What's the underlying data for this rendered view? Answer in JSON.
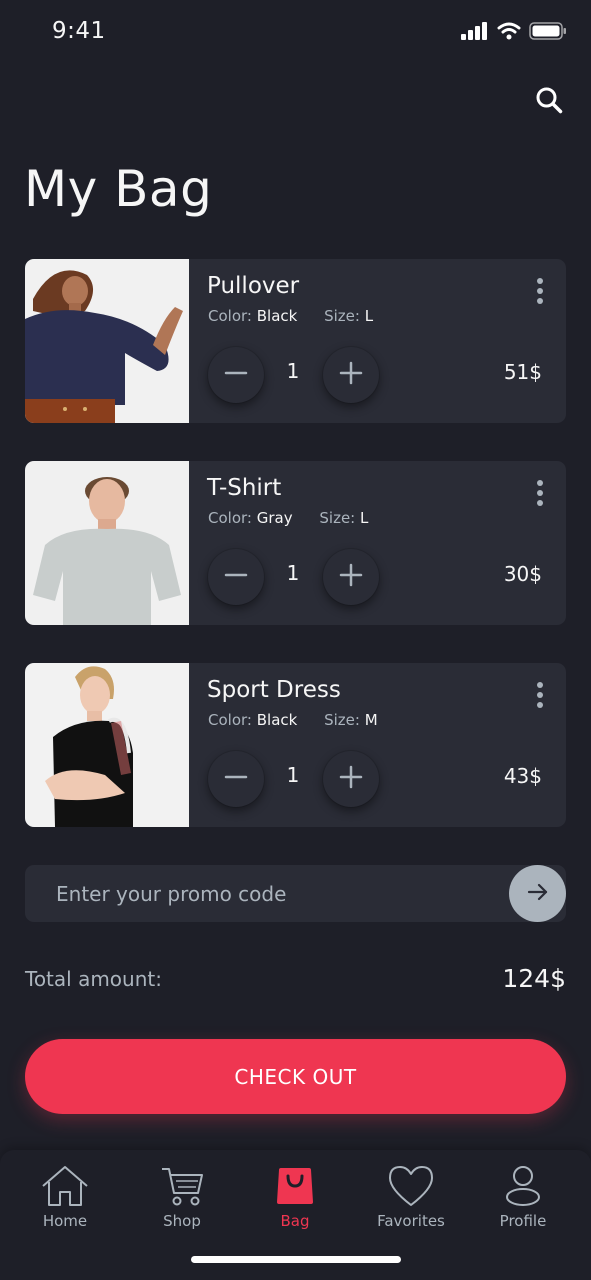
{
  "status_bar": {
    "time": "9:41",
    "icons": [
      "signal-icon",
      "wifi-icon",
      "battery-icon"
    ]
  },
  "header": {
    "search_icon": "search-icon",
    "title": "My Bag"
  },
  "labels": {
    "color": "Color:",
    "size": "Size:"
  },
  "cart_items": [
    {
      "name": "Pullover",
      "color": "Black",
      "size": "L",
      "quantity": "1",
      "price": "51$",
      "image": "woman-navy-pullover"
    },
    {
      "name": "T-Shirt",
      "color": "Gray",
      "size": "L",
      "quantity": "1",
      "price": "30$",
      "image": "man-gray-tshirt"
    },
    {
      "name": "Sport Dress",
      "color": "Black",
      "size": "M",
      "quantity": "1",
      "price": "43$",
      "image": "woman-black-sport-dress"
    }
  ],
  "promo": {
    "placeholder": "Enter your promo code",
    "submit_icon": "arrow-right-icon"
  },
  "total": {
    "label": "Total amount:",
    "value": "124$"
  },
  "checkout": {
    "label": "CHECK OUT"
  },
  "tab_bar": {
    "active": "bag",
    "items": [
      {
        "label": "Home",
        "icon": "home-icon"
      },
      {
        "label": "Shop",
        "icon": "cart-icon"
      },
      {
        "label": "Bag",
        "icon": "bag-icon"
      },
      {
        "label": "Favorites",
        "icon": "heart-icon"
      },
      {
        "label": "Profile",
        "icon": "profile-icon"
      }
    ]
  },
  "colors": {
    "background": "#1e1f28",
    "card": "#2a2c36",
    "primary": "#ef3651",
    "text": "#f6f6f6",
    "muted": "#abb4bd"
  }
}
